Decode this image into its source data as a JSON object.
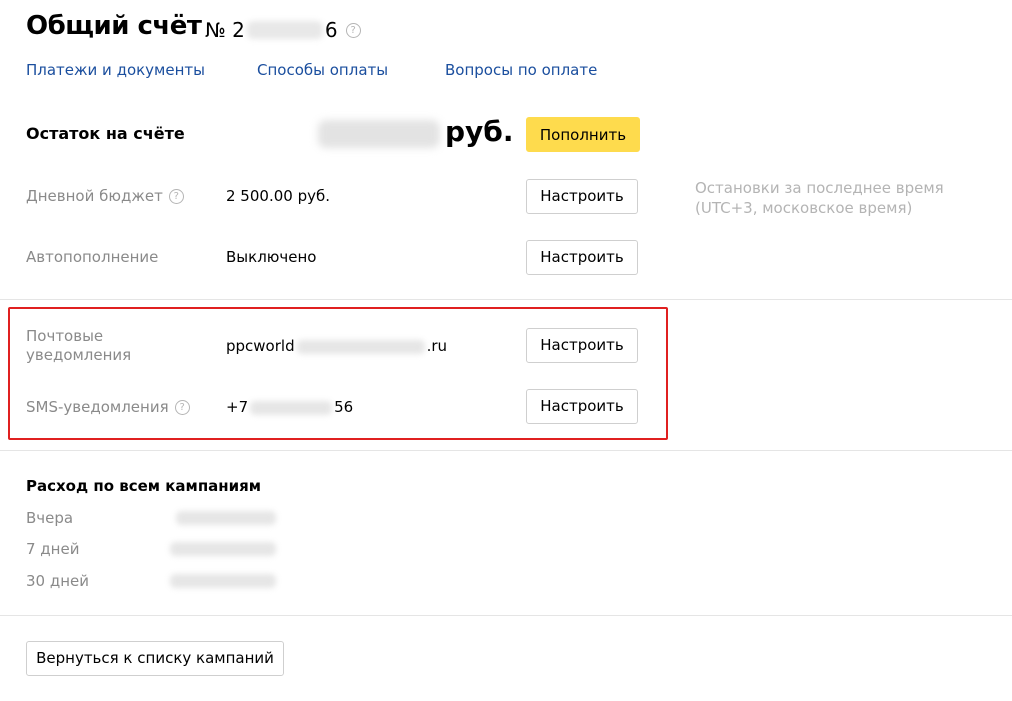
{
  "header": {
    "title": "Общий счёт",
    "account_prefix": "№ 2",
    "account_suffix": "6",
    "help_glyph": "?"
  },
  "nav": {
    "payments_docs": "Платежи и документы",
    "payment_methods": "Способы оплаты",
    "payment_questions": "Вопросы по оплате"
  },
  "balance": {
    "label": "Остаток на счёте",
    "currency": "руб.",
    "topup_button": "Пополнить"
  },
  "settings": {
    "daily_budget": {
      "label": "Дневной бюджет",
      "value": "2 500.00 руб.",
      "button": "Настроить"
    },
    "autopay": {
      "label": "Автопополнение",
      "value": "Выключено",
      "button": "Настроить"
    },
    "email": {
      "label_line1": "Почтовые",
      "label_line2": "уведомления",
      "value_prefix": "ppcworld",
      "value_suffix": ".ru",
      "button": "Настроить"
    },
    "sms": {
      "label": "SMS-уведомления",
      "value_prefix": "+7",
      "value_suffix": "56",
      "button": "Настроить"
    }
  },
  "stops_note": {
    "line1": "Остановки за последнее время",
    "line2": "(UTC+3, московское время)"
  },
  "spend": {
    "title": "Расход по всем кампаниям",
    "rows": [
      {
        "label": "Вчера"
      },
      {
        "label": "7 дней"
      },
      {
        "label": "30 дней"
      }
    ]
  },
  "footer": {
    "back_button": "Вернуться к списку кампаний"
  },
  "colors": {
    "accent_yellow": "#fedb4d",
    "link_blue": "#1a4e9e",
    "highlight_red": "#e02020"
  }
}
